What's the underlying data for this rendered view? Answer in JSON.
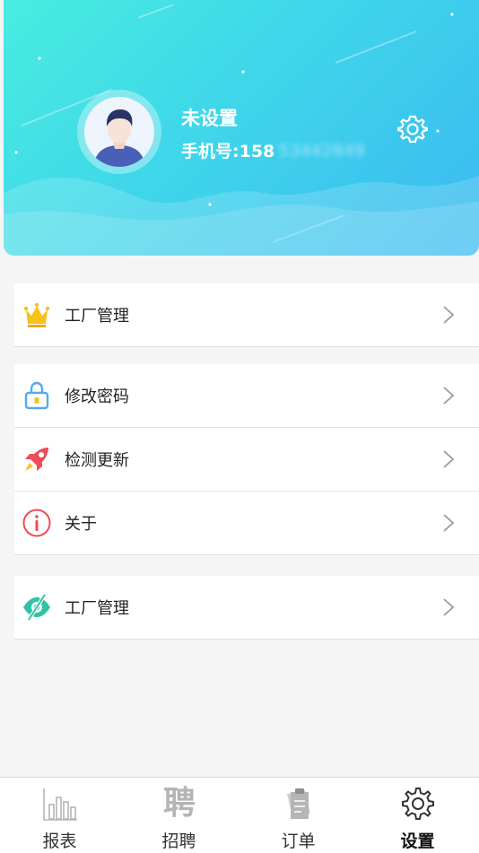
{
  "profile": {
    "name": "未设置",
    "phone_prefix": "手机号:158",
    "phone_masked": "53442849"
  },
  "colors": {
    "header_start": "#49ece0",
    "header_end": "#3ab9f1",
    "crown": "#f6c21c",
    "lock": "#5aa8e8",
    "rocket": "#ef4b5a",
    "info": "#ef4b5a",
    "eye": "#2fc3a6"
  },
  "menu_groups": [
    {
      "items": [
        {
          "label": "工厂管理",
          "icon": "crown-icon"
        }
      ]
    },
    {
      "items": [
        {
          "label": "修改密码",
          "icon": "lock-icon"
        },
        {
          "label": "检测更新",
          "icon": "rocket-icon"
        },
        {
          "label": "关于",
          "icon": "info-icon"
        }
      ]
    },
    {
      "items": [
        {
          "label": "工厂管理",
          "icon": "eye-slash-icon"
        }
      ]
    }
  ],
  "tabs": [
    {
      "label": "报表",
      "icon": "chart-icon"
    },
    {
      "label": "招聘",
      "icon": "recruit-icon",
      "glyph": "聘"
    },
    {
      "label": "订单",
      "icon": "order-icon"
    },
    {
      "label": "设置",
      "icon": "gear-icon",
      "active": true
    }
  ]
}
